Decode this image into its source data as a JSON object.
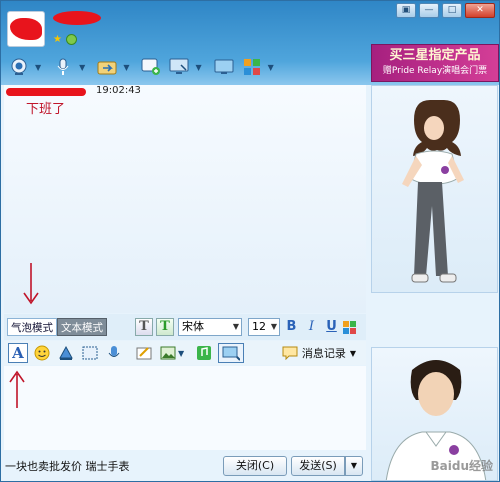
{
  "window": {
    "controls": [
      "▣",
      "—",
      "□",
      "✕"
    ]
  },
  "toolbar": {
    "icons": [
      "webcam-icon",
      "microphone-icon",
      "file-transfer-icon",
      "add-app-icon",
      "screen-share-icon",
      "remote-desktop-icon",
      "apps-grid-icon"
    ]
  },
  "ad": {
    "line1": "买三星指定产品",
    "line2": "赠Pride Relay演唱会门票"
  },
  "chat": {
    "time": "19:02:43",
    "message": "下班了"
  },
  "format": {
    "bubble_mode": "气泡模式",
    "text_mode": "文本模式",
    "font": "宋体",
    "size": "12",
    "bold": "B",
    "italic": "I",
    "underline": "U"
  },
  "tools": {
    "font_btn": "A",
    "message_log": "消息记录"
  },
  "bottom": {
    "ad_text": "一块也卖批发价 瑞士手表",
    "close": "关闭(C)",
    "send": "发送(S)"
  },
  "watermark": "Baidu经验",
  "colors": {
    "accent": "#2f86c6",
    "redline": "#c0152a"
  }
}
